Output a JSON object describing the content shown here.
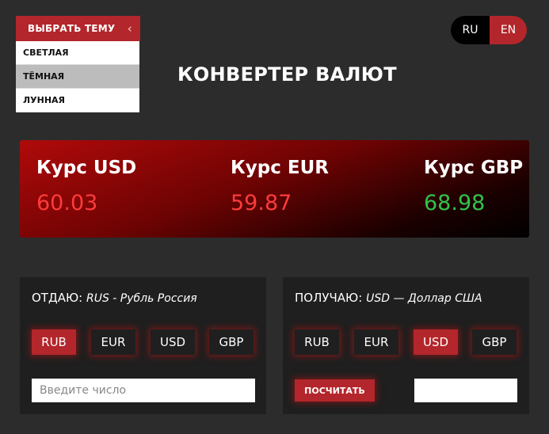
{
  "theme_menu": {
    "toggle_label": "ВЫБРАТЬ ТЕМУ",
    "toggle_icon": "chevron-left-icon",
    "options": [
      "СВЕТЛАЯ",
      "ТЁМНАЯ",
      "ЛУННАЯ"
    ],
    "active": "ТЁМНАЯ"
  },
  "language": {
    "ru": "RU",
    "en": "EN",
    "active": "EN"
  },
  "title": "КОНВЕРТЕР ВАЛЮТ",
  "rates": [
    {
      "label": "Курс USD",
      "value": "60.03",
      "color": "#ff3b3b"
    },
    {
      "label": "Курс EUR",
      "value": "59.87",
      "color": "#ff3b3b"
    },
    {
      "label": "Курс GBP",
      "value": "68.98",
      "color": "#33c24a"
    }
  ],
  "give": {
    "heading": "ОТДАЮ:",
    "currency_desc": "RUS - Рубль Россия",
    "currencies": [
      "RUB",
      "EUR",
      "USD",
      "GBP"
    ],
    "active": "RUB",
    "input_placeholder": "Введите число",
    "input_value": ""
  },
  "get": {
    "heading": "ПОЛУЧАЮ:",
    "currency_desc": "USD — Доллар США",
    "currencies": [
      "RUB",
      "EUR",
      "USD",
      "GBP"
    ],
    "active": "USD",
    "calc_label": "ПОСЧИТАТЬ",
    "result_value": ""
  },
  "colors": {
    "accent": "#b3262b",
    "background": "#2c2c2c",
    "panel": "#1f1f1f"
  }
}
